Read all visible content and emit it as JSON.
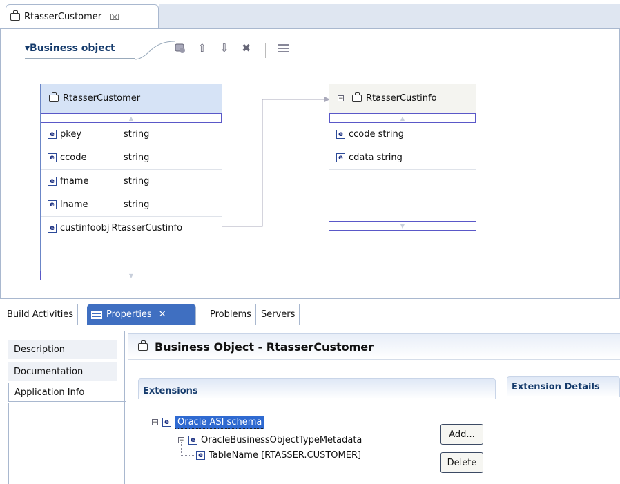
{
  "editor": {
    "tab_label": "RtasserCustomer",
    "section_label": "▾Business object",
    "toolbar_icons": [
      "add-attribute-icon",
      "move-up-icon",
      "move-down-icon",
      "delete-icon",
      "layout-icon"
    ]
  },
  "diagram": {
    "customer": {
      "title": "RtasserCustomer",
      "fields": [
        {
          "name": "pkey",
          "type": "string"
        },
        {
          "name": "ccode",
          "type": "string"
        },
        {
          "name": "fname",
          "type": "string"
        },
        {
          "name": "lname",
          "type": "string"
        },
        {
          "name": "custinfoobj",
          "type": "RtasserCustinfo"
        }
      ]
    },
    "custinfo": {
      "title": "RtasserCustinfo",
      "fields": [
        {
          "label": "ccode string"
        },
        {
          "label": "cdata string"
        }
      ]
    }
  },
  "panel": {
    "tabs": {
      "build": "Build Activities",
      "properties": "Properties",
      "problems": "Problems",
      "servers": "Servers"
    },
    "sidebar": {
      "description": "Description",
      "documentation": "Documentation",
      "application_info": "Application Info"
    },
    "title": "Business Object - RtasserCustomer",
    "extensions_label": "Extensions",
    "extension_details_label": "Extension Details",
    "tree": {
      "root": "Oracle ASI schema",
      "child": "OracleBusinessObjectTypeMetadata",
      "leaf": "TableName [RTASSER.CUSTOMER]"
    },
    "add_label": "Add...",
    "delete_label": "Delete"
  }
}
